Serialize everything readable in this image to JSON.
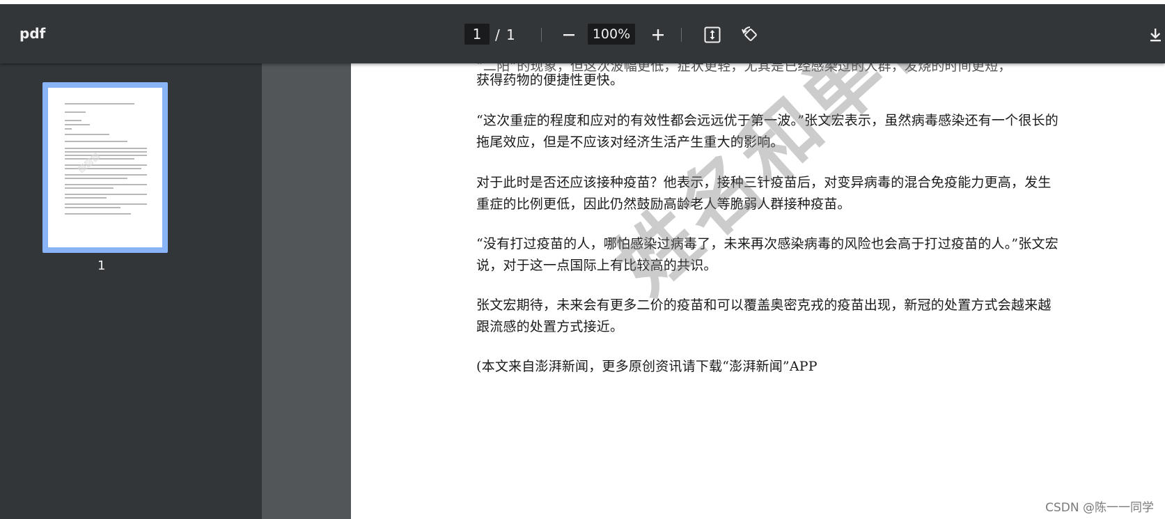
{
  "toolbar": {
    "title": "pdf",
    "page_current": "1",
    "page_separator": "/",
    "page_total": "1",
    "zoom": "100%"
  },
  "icons": {
    "zoom_out": "minus-icon",
    "zoom_in": "plus-icon",
    "fit": "fit-to-page-icon",
    "rotate": "rotate-icon",
    "download": "download-icon"
  },
  "sidebar": {
    "thumbnail_label": "1"
  },
  "document": {
    "top_partial": "“二阳”的现象，但这次波幅更低，症状更轻，尤其是已经感染过的人群，发烧的时间更短，",
    "paragraphs": [
      "获得药物的便捷性更快。",
      "“这次重症的程度和应对的有效性都会远远优于第一波。”张文宏表示，虽然病毒感染还有一个很长的拖尾效应，但是不应该对经济生活产生重大的影响。",
      "对于此时是否还应该接种疫苗？他表示，接种三针疫苗后，对变异病毒的混合免疫能力更高，发生重症的比例更低，因此仍然鼓励高龄老人等脆弱人群接种疫苗。",
      "“没有打过疫苗的人，哪怕感染过病毒了，未来再次感染病毒的风险也会高于打过疫苗的人。”张文宏说，对于这一点国际上有比较高的共识。",
      "张文宏期待，未来会有更多二价的疫苗和可以覆盖奥密克戎的疫苗出现，新冠的处置方式会越来越跟流感的处置方式接近。",
      "(本文来自澎湃新闻，更多原创资讯请下载“澎湃新闻”APP"
    ],
    "watermark": "姓名和单位"
  },
  "credit": "CSDN @陈一一同学",
  "colors": {
    "toolbar_bg": "#323639",
    "viewer_bg": "#525659",
    "thumb_selected": "#8ab4f8"
  }
}
